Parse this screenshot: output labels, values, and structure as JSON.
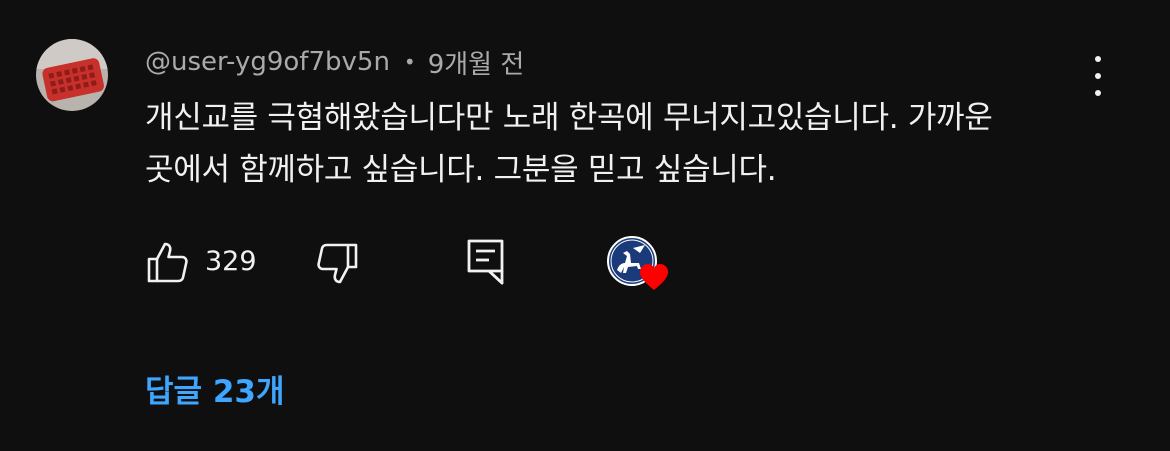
{
  "comment": {
    "author": "@user-yg9of7bv5n",
    "separator": "•",
    "timestamp": "9개월 전",
    "text_lines": [
      "개신교를 극혐해왔습니다만 노래 한곡에 무너지고있습니다. 가까운",
      "곳에서 함께하고 싶습니다. 그분을 믿고 싶습니다."
    ],
    "like_count": "329",
    "creator_heart": true
  },
  "replies": {
    "label": "답글 23개"
  },
  "icons": {
    "like": "thumbs-up-icon",
    "dislike": "thumbs-down-icon",
    "reply": "reply-comment-icon",
    "more": "more-vertical-icon",
    "heart": "heart-icon"
  },
  "colors": {
    "background": "#0f0f0f",
    "text": "#f1f1f1",
    "secondary_text": "#aaaaaa",
    "link": "#3ea6ff",
    "heart": "#ff0000",
    "channel_avatar_bg": "#1a3a7a"
  }
}
